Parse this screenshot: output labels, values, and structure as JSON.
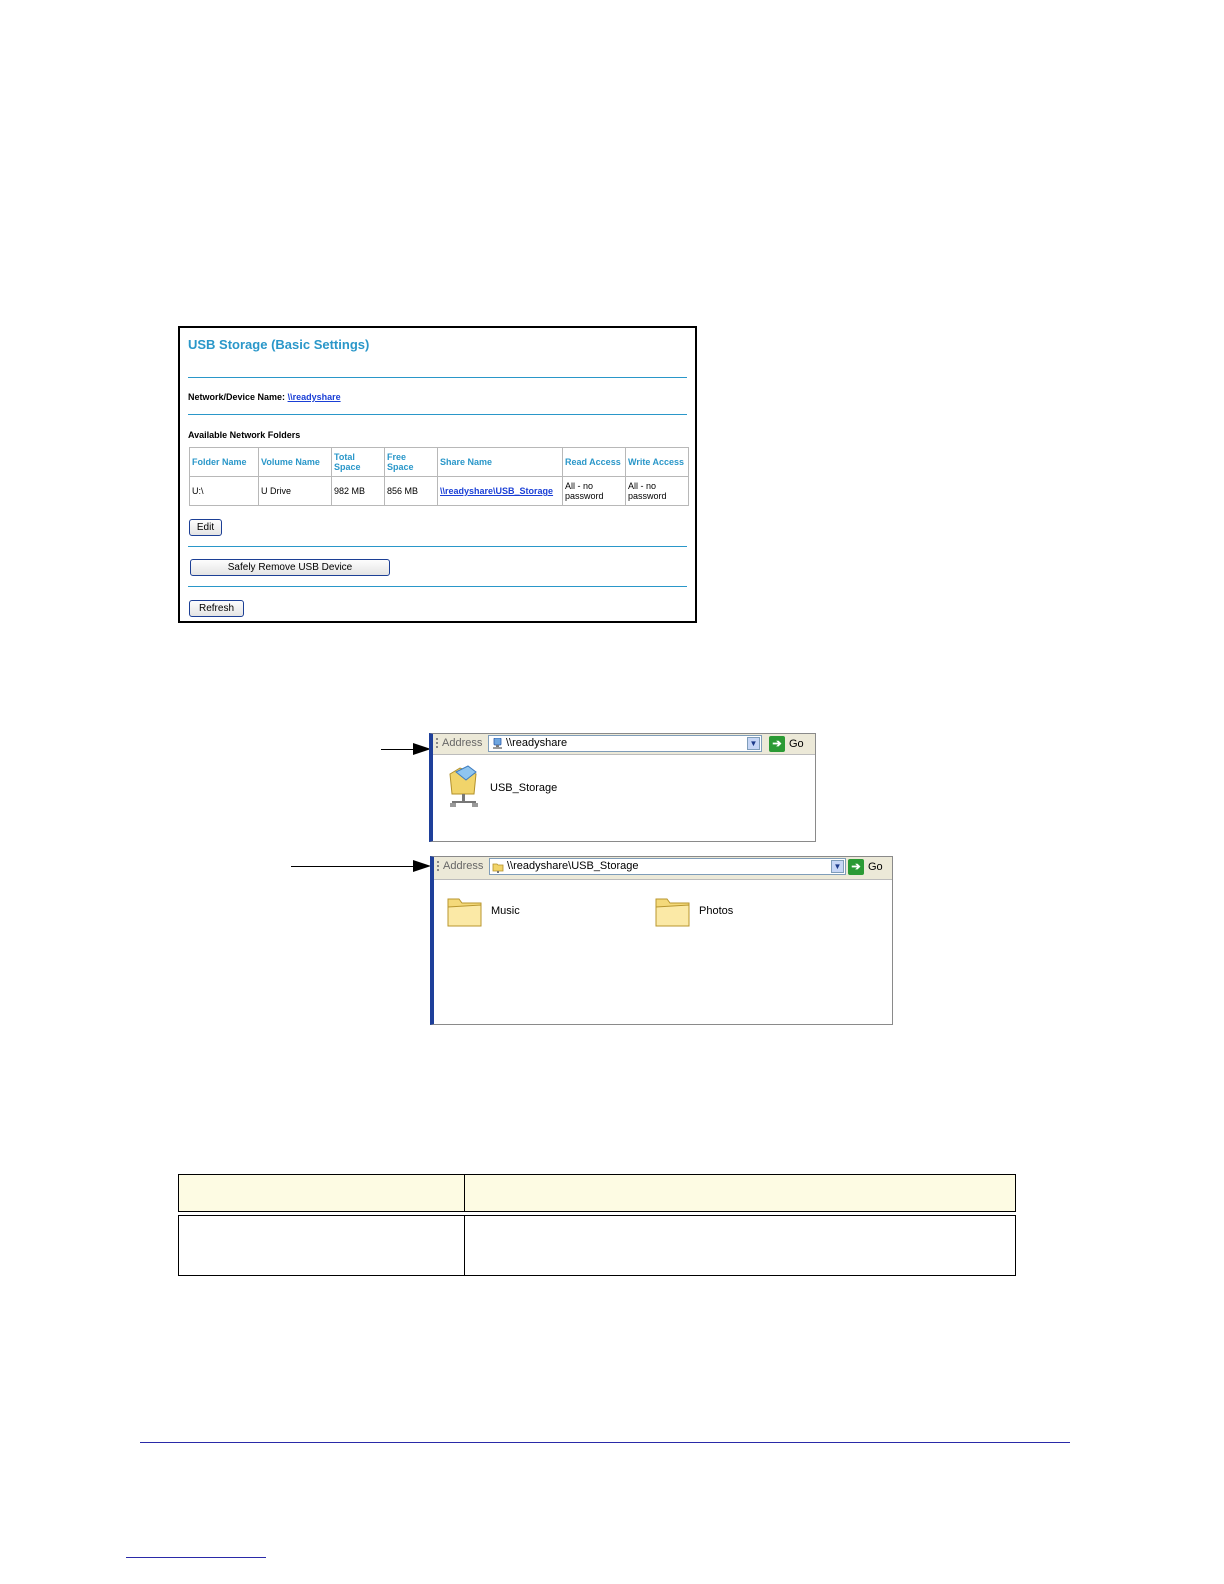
{
  "router_panel": {
    "title": "USB Storage (Basic Settings)",
    "device_name_label": "Network/Device Name:",
    "device_name_value": "\\\\readyshare",
    "available_label": "Available Network Folders",
    "table_headers": [
      "Folder Name",
      "Volume Name",
      "Total Space",
      "Free Space",
      "Share Name",
      "Read Access",
      "Write Access"
    ],
    "table_row": {
      "folder_name": "U:\\",
      "volume_name": "U Drive",
      "total_space": "982 MB",
      "free_space": "856 MB",
      "share_name": "\\\\readyshare\\USB_Storage",
      "read_access": "All - no password",
      "write_access": "All - no password"
    },
    "edit_button": "Edit",
    "remove_button": "Safely Remove USB Device",
    "refresh_button": "Refresh"
  },
  "explorer_top": {
    "address_label": "Address",
    "address_value": "\\\\readyshare",
    "go_label": "Go",
    "items": [
      {
        "label": "USB_Storage",
        "icon": "network-share-icon"
      }
    ]
  },
  "explorer_bottom": {
    "address_label": "Address",
    "address_value": "\\\\readyshare\\USB_Storage",
    "go_label": "Go",
    "items": [
      {
        "label": "Music",
        "icon": "folder-icon"
      },
      {
        "label": "Photos",
        "icon": "folder-icon"
      }
    ]
  },
  "colors": {
    "accent": "#2a97c9",
    "link": "#1a3fd6",
    "table_header_bg": "#fdfbe3",
    "window_border": "#1e3f9a"
  }
}
